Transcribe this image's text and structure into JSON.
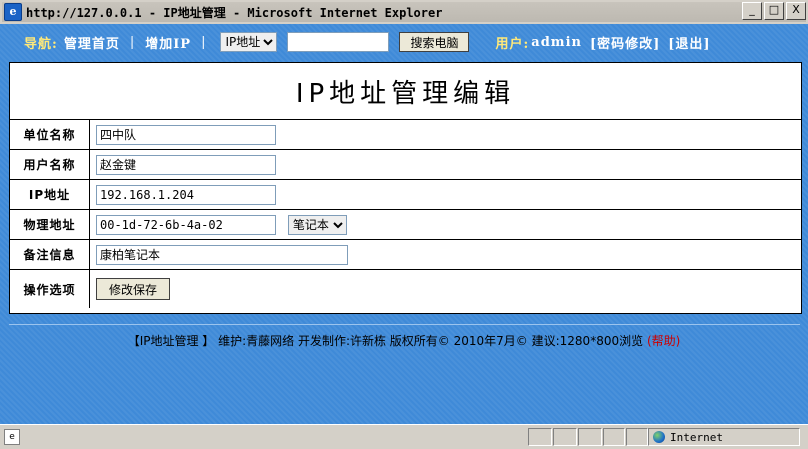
{
  "window": {
    "title": "http://127.0.0.1 - IP地址管理 - Microsoft Internet Explorer",
    "buttons": [
      "_",
      "□",
      "X"
    ]
  },
  "nav": {
    "label": "导航:",
    "home": "管理首页",
    "add_ip": "增加IP",
    "select_value": "IP地址",
    "search_button": "搜索电脑",
    "user_label": "用户:",
    "user_name": "admin",
    "change_password": "[密码修改]",
    "logout": "[退出]"
  },
  "page": {
    "title": "IP地址管理编辑"
  },
  "form": {
    "unit_label": "单位名称",
    "unit_value": "四中队",
    "user_label": "用户名称",
    "user_value": "赵金键",
    "ip_label": "IP地址",
    "ip_value": "192.168.1.204",
    "mac_label": "物理地址",
    "mac_value": "00-1d-72-6b-4a-02",
    "device_type": "笔记本",
    "note_label": "备注信息",
    "note_value": "康柏笔记本",
    "ops_label": "操作选项",
    "save_button": "修改保存"
  },
  "footer": {
    "text": "【IP地址管理 】 维护:青藤网络 开发制作:许新栋 版权所有© 2010年7月©    建议:1280*800浏览",
    "help": "(帮助)"
  },
  "statusbar": {
    "zone": "Internet"
  }
}
